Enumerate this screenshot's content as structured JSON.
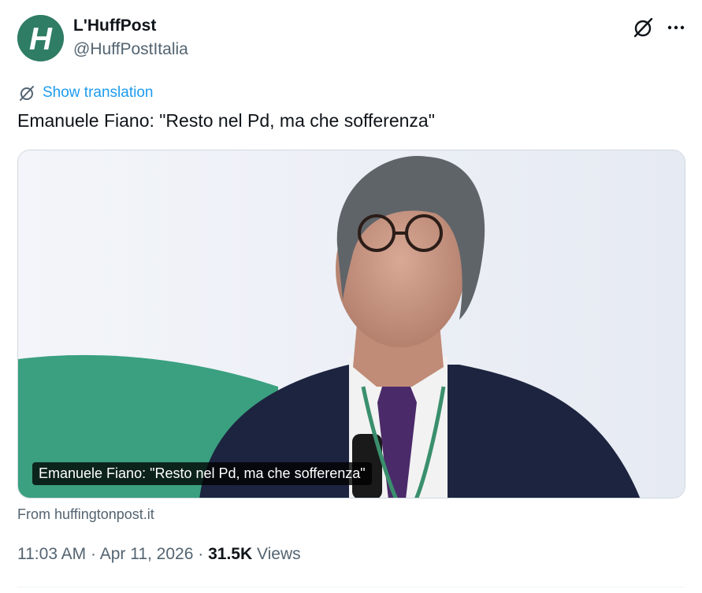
{
  "author": {
    "name": "L'HuffPost",
    "handle": "@HuffPostItalia",
    "avatar_letter": "H",
    "avatar_color": "#2f7d64"
  },
  "actions": {
    "grok_icon": "grok-icon",
    "more_icon": "more-icon"
  },
  "translation": {
    "label": "Show translation",
    "icon": "translate-icon"
  },
  "tweet": {
    "text": "Emanuele Fiano: \"Resto nel Pd, ma che sofferenza\""
  },
  "card": {
    "caption": "Emanuele Fiano: \"Resto nel Pd, ma che sofferenza\"",
    "source": "From huffingtonpost.it"
  },
  "meta": {
    "time": "11:03 AM",
    "separator": "·",
    "date": "Apr 11, 2026",
    "views_count": "31.5K",
    "views_label": "Views"
  },
  "colors": {
    "accent": "#1d9bf0",
    "secondary_text": "#536471",
    "primary_text": "#0f1419",
    "border": "#cfd9de"
  }
}
